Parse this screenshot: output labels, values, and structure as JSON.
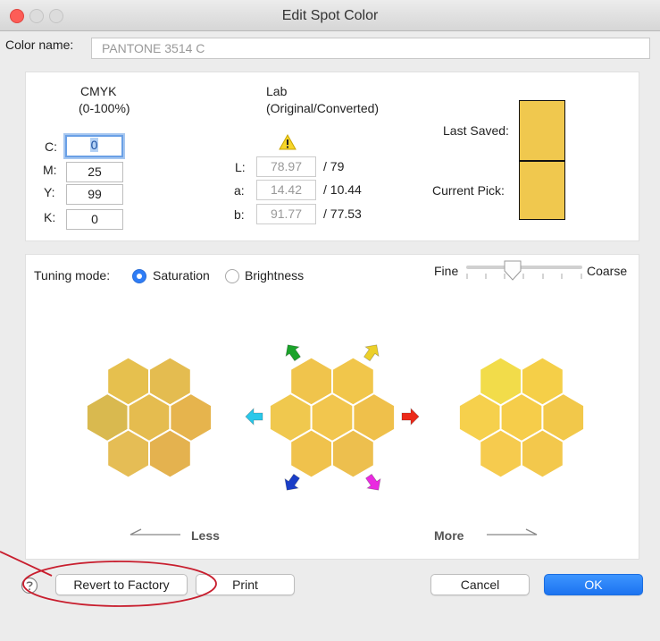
{
  "window": {
    "title": "Edit Spot Color"
  },
  "color_name": {
    "label": "Color name:",
    "value": "PANTONE 3514 C"
  },
  "cmyk": {
    "heading": "CMYK",
    "subheading": "(0-100%)",
    "rows": [
      {
        "label": "C:",
        "value": "0"
      },
      {
        "label": "M:",
        "value": "25"
      },
      {
        "label": "Y:",
        "value": "99"
      },
      {
        "label": "K:",
        "value": "0"
      }
    ]
  },
  "lab": {
    "heading": "Lab",
    "subheading": "(Original/Converted)",
    "warning_icon": "warning-triangle-icon",
    "rows": [
      {
        "label": "L:",
        "original": "78.97",
        "converted": "/ 79"
      },
      {
        "label": "a:",
        "original": "14.42",
        "converted": "/ 10.44"
      },
      {
        "label": "b:",
        "original": "91.77",
        "converted": "/ 77.53"
      }
    ]
  },
  "swatches": {
    "last_saved_label": "Last Saved:",
    "current_pick_label": "Current Pick:",
    "last_saved_color": "#f0c84e",
    "current_pick_color": "#f0c84e"
  },
  "tuning": {
    "label": "Tuning mode:",
    "options": [
      {
        "label": "Saturation",
        "selected": true
      },
      {
        "label": "Brightness",
        "selected": false
      }
    ],
    "slider": {
      "left_label": "Fine",
      "right_label": "Coarse",
      "level": 0.4
    }
  },
  "hex_groups": {
    "less_colors": [
      "#e6c04e",
      "#e4bc50",
      "#d9b94f",
      "#e5bc4f",
      "#e6b44d",
      "#e5bd55",
      "#e4b24f"
    ],
    "current_colors": [
      "#f0c44c",
      "#f1c64b",
      "#f0c84e",
      "#f2c64e",
      "#efc04b",
      "#f0c24c",
      "#edbf4e"
    ],
    "more_colors": [
      "#f2dc4a",
      "#f5cf48",
      "#f6d04c",
      "#f6cd4a",
      "#f2c84a",
      "#f6cb4e",
      "#f3c84c"
    ],
    "arrow_colors": {
      "green": "#1aa32a",
      "yellow": "#ecd02a",
      "cyan": "#2ac8ea",
      "red": "#ec2a1a",
      "blue": "#1a3ec8",
      "magenta": "#ea2ae0"
    },
    "less_label": "Less",
    "more_label": "More"
  },
  "footer": {
    "help_icon": "help-icon",
    "revert_label": "Revert to Factory",
    "print_label": "Print",
    "cancel_label": "Cancel",
    "ok_label": "OK",
    "annotation_color": "#c81e2e"
  }
}
